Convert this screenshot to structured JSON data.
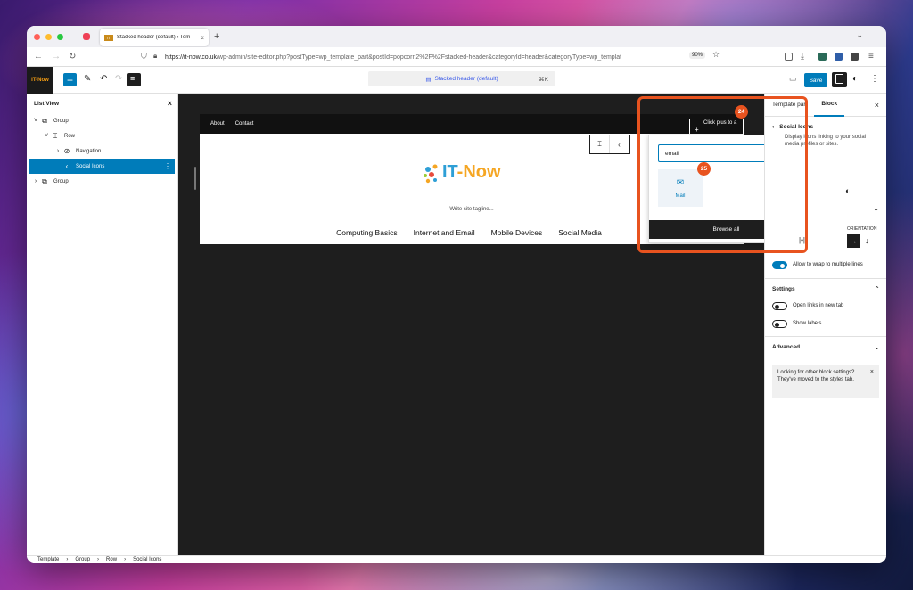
{
  "browser": {
    "tab_title": "Stacked header (default) ‹ Tem",
    "tab_favicon": "IT",
    "url_host": "https://it-now.co.uk",
    "url_path": "/wp-admin/site-editor.php?postType=wp_template_part&postId=popcorn2%2F%2Fstacked-header&categoryId=header&categoryType=wp_templat",
    "zoom": "90%"
  },
  "toolbar": {
    "logo_text": "IT-Now",
    "document_title": "Stacked header (default)",
    "shortcut": "⌘K",
    "save_label": "Save"
  },
  "list_view": {
    "title": "List View",
    "items": [
      {
        "label": "Group",
        "chev": "˅",
        "icon": "⧉"
      },
      {
        "label": "Row",
        "chev": "˅",
        "icon": "⌶"
      },
      {
        "label": "Navigation",
        "chev": "›",
        "icon": "⊘"
      },
      {
        "label": "Social Icons",
        "chev": "",
        "icon": "‹"
      },
      {
        "label": "Group",
        "chev": "›",
        "icon": "⧉"
      }
    ]
  },
  "canvas": {
    "nav_links": [
      "About",
      "Contact"
    ],
    "click_plus": "Click plus to a",
    "logo_text_a": "IT",
    "logo_text_b": "-Now",
    "tagline": "Write site tagline...",
    "menu": [
      "Computing Basics",
      "Internet and Email",
      "Mobile Devices",
      "Social Media"
    ]
  },
  "inserter": {
    "search_value": "email",
    "result_label": "Mail",
    "browse_all": "Browse all"
  },
  "annotations": {
    "badge_a": "24",
    "badge_b": "25"
  },
  "sidebar": {
    "tab_template_part": "Template part",
    "tab_block": "Block",
    "block_name": "Social Icons",
    "block_desc": "Display icons linking to your social media profiles or sites.",
    "orientation_label": "ORIENTATION",
    "wrap_label": "Allow to wrap to multiple lines",
    "settings_title": "Settings",
    "new_tab_label": "Open links in new tab",
    "show_labels_label": "Show labels",
    "advanced_title": "Advanced",
    "notice": "Looking for other block settings? They've moved to the styles tab."
  },
  "breadcrumb": [
    "Template",
    "Group",
    "Row",
    "Social Icons"
  ],
  "colors": {
    "accent": "#007cba",
    "annotation": "#e8531f"
  }
}
